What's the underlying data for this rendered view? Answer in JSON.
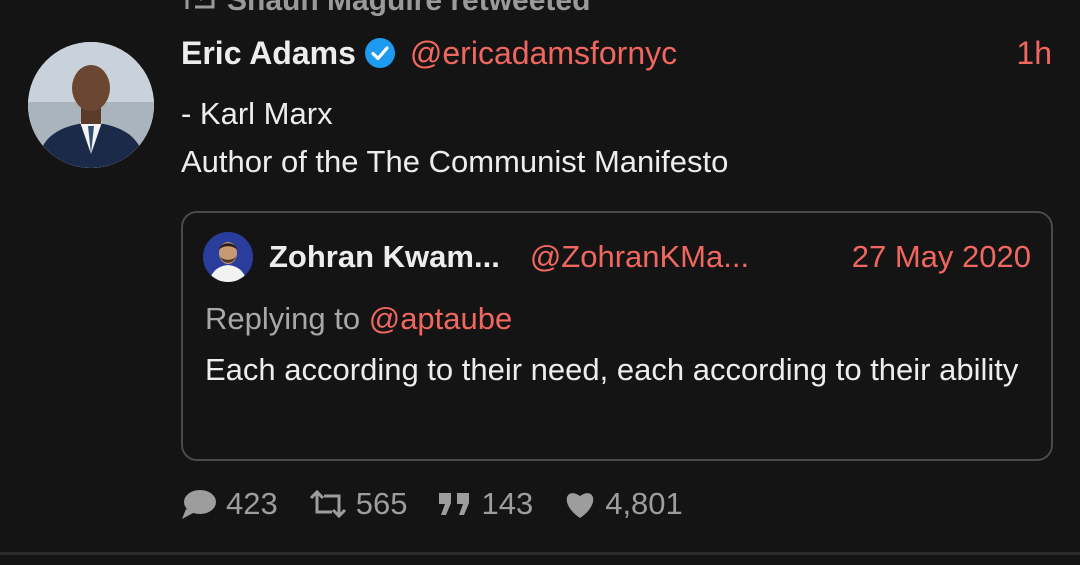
{
  "retweet": {
    "icon": "retweet-icon",
    "text": "Shaun Maguire retweeted"
  },
  "tweet": {
    "author_name": "Eric Adams",
    "verified_icon": "verified-badge-icon",
    "handle": "@ericadamsfornyc",
    "time": "1h",
    "lines": [
      "- Karl Marx",
      "Author of the The Communist Manifesto"
    ]
  },
  "quote": {
    "author_name": "Zohran Kwam...",
    "handle": "@ZohranKMa...",
    "date": "27 May 2020",
    "reply_prefix": "Replying to",
    "reply_mention": "@aptaube",
    "text": "Each according to their need, each according to their ability"
  },
  "stats": {
    "replies": "423",
    "retweets": "565",
    "quotes": "143",
    "likes": "4,801"
  },
  "colors": {
    "background": "#141414",
    "accent": "#f0675f",
    "verified": "#1d9bf0",
    "muted": "#9d9d9d"
  }
}
